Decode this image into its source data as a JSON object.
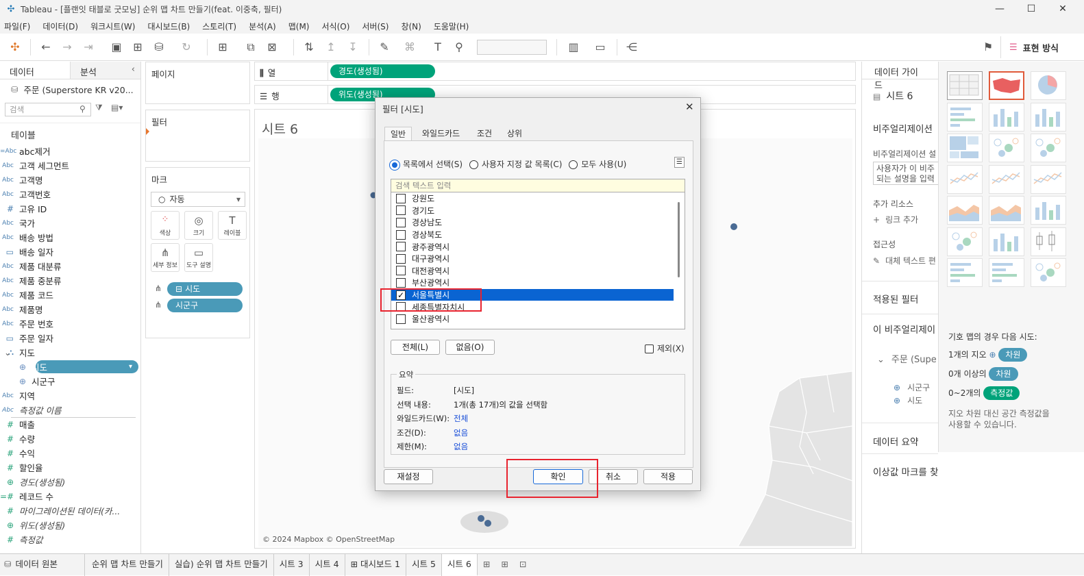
{
  "app": {
    "title": "Tableau - [플랜잇 태블로 굿모닝] 순위 맵 차트 만들기(feat. 이중축, 필터)"
  },
  "menu": [
    "파일(F)",
    "데이터(D)",
    "워크시트(W)",
    "대시보드(B)",
    "스토리(T)",
    "분석(A)",
    "맵(M)",
    "서식(O)",
    "서버(S)",
    "창(N)",
    "도움말(H)"
  ],
  "toolbar": {
    "show_me_label": "표현 방식"
  },
  "data_pane": {
    "tab_data": "데이터",
    "tab_analysis": "분석",
    "datasource": "주문 (Superstore KR v20...",
    "search_placeholder": "검색",
    "tables_header": "테이블",
    "fields": [
      {
        "icon": "=Abc",
        "name": "abc제거",
        "type": "dim"
      },
      {
        "icon": "Abc",
        "name": "고객 세그먼트",
        "type": "dim"
      },
      {
        "icon": "Abc",
        "name": "고객명",
        "type": "dim"
      },
      {
        "icon": "Abc",
        "name": "고객번호",
        "type": "dim"
      },
      {
        "icon": "#",
        "name": "고유 ID",
        "type": "dim"
      },
      {
        "icon": "Abc",
        "name": "국가",
        "type": "dim"
      },
      {
        "icon": "Abc",
        "name": "배송 방법",
        "type": "dim"
      },
      {
        "icon": "▭",
        "name": "배송 일자",
        "type": "dim"
      },
      {
        "icon": "Abc",
        "name": "제품 대분류",
        "type": "dim"
      },
      {
        "icon": "Abc",
        "name": "제품 중분류",
        "type": "dim"
      },
      {
        "icon": "Abc",
        "name": "제품 코드",
        "type": "dim"
      },
      {
        "icon": "Abc",
        "name": "제품명",
        "type": "dim"
      },
      {
        "icon": "Abc",
        "name": "주문 번호",
        "type": "dim"
      },
      {
        "icon": "▭",
        "name": "주문 일자",
        "type": "dim"
      },
      {
        "icon": "⛬",
        "name": "지도",
        "type": "hier"
      },
      {
        "icon": "⊕",
        "name": "시도",
        "type": "geo-selected"
      },
      {
        "icon": "⊕",
        "name": "시군구",
        "type": "geo"
      },
      {
        "icon": "Abc",
        "name": "지역",
        "type": "dim"
      },
      {
        "icon": "Abc",
        "name": "측정값 이름",
        "type": "dim-italic"
      },
      {
        "icon": "#",
        "name": "매출",
        "type": "meas"
      },
      {
        "icon": "#",
        "name": "수량",
        "type": "meas"
      },
      {
        "icon": "#",
        "name": "수익",
        "type": "meas"
      },
      {
        "icon": "#",
        "name": "할인율",
        "type": "meas"
      },
      {
        "icon": "⊕",
        "name": "경도(생성됨)",
        "type": "meas-italic"
      },
      {
        "icon": "=#",
        "name": "레코드 수",
        "type": "meas"
      },
      {
        "icon": "#",
        "name": "마이그레이션된 데이터(카...",
        "type": "meas-italic"
      },
      {
        "icon": "⊕",
        "name": "위도(생성됨)",
        "type": "meas-italic"
      },
      {
        "icon": "#",
        "name": "측정값",
        "type": "meas-italic"
      }
    ]
  },
  "shelves": {
    "pages_label": "페이지",
    "filters_label": "필터",
    "marks_label": "마크",
    "mark_type": "자동",
    "columns_label": "열",
    "rows_label": "행",
    "columns_pill": "경도(생성됨)",
    "rows_pill": "위도(생성됨)",
    "mark_buttons": [
      "색상",
      "크기",
      "레이블",
      "세부 정보",
      "도구 설명"
    ],
    "mark_pills": [
      "시도",
      "시군구"
    ]
  },
  "sheet": {
    "title": "시트 6",
    "attribution": "© 2024 Mapbox © OpenStreetMap"
  },
  "dialog": {
    "title": "필터 [시도]",
    "tabs": [
      "일반",
      "와일드카드",
      "조건",
      "상위"
    ],
    "radio_list": "목록에서 선택(S)",
    "radio_custom": "사용자 지정 값 목록(C)",
    "radio_all": "모두 사용(U)",
    "search_placeholder": "검색 텍스트 입력",
    "items": [
      {
        "label": "강원도",
        "checked": false
      },
      {
        "label": "경기도",
        "checked": false
      },
      {
        "label": "경상남도",
        "checked": false
      },
      {
        "label": "경상북도",
        "checked": false
      },
      {
        "label": "광주광역시",
        "checked": false
      },
      {
        "label": "대구광역시",
        "checked": false
      },
      {
        "label": "대전광역시",
        "checked": false
      },
      {
        "label": "부산광역시",
        "checked": false
      },
      {
        "label": "서울특별시",
        "checked": true
      },
      {
        "label": "세종특별자치시",
        "checked": false
      },
      {
        "label": "울산광역시",
        "checked": false
      }
    ],
    "all_button": "전체(L)",
    "none_button": "없음(O)",
    "exclude_label": "제외(X)",
    "summary_header": "요약",
    "summary": [
      {
        "k": "필드:",
        "v": "[시도]",
        "link": false
      },
      {
        "k": "선택 내용:",
        "v": "1개(총 17개)의 값을 선택함",
        "link": false
      },
      {
        "k": "와일드카드(W):",
        "v": "전체",
        "link": true
      },
      {
        "k": "조건(D):",
        "v": "없음",
        "link": true
      },
      {
        "k": "제한(M):",
        "v": "없음",
        "link": true
      }
    ],
    "reset_button": "재설정",
    "ok_button": "확인",
    "cancel_button": "취소",
    "apply_button": "적용"
  },
  "guide": {
    "header": "데이터 가이드",
    "sheet": "시트 6",
    "viz_header": "비주얼리제이션",
    "viz_desc_label": "비주얼리제이션 설",
    "desc_placeholder": "사용자가 이 비주\n되는 설명을 입력",
    "resources_label": "추가 리소스",
    "add_link": "링크 추가",
    "access_label": "접근성",
    "alt_text": "대체 텍스트 편",
    "applied_filters": "적용된 필터",
    "this_viz": "이 비주얼리제이",
    "datasource": "주문 (Supe",
    "geo1": "시군구",
    "geo2": "시도",
    "data_summary": "데이터 요약",
    "outliers": "이상값 마크를 찾을 수 없음"
  },
  "showme": {
    "hint_title": "기호 맵의 경우 다음 시도:",
    "r1_label": "1개의 지오",
    "r1_chip": "차원",
    "r2_label": "0개 이상의",
    "r2_chip": "차원",
    "r3_label": "0~2개의",
    "r3_chip": "측정값",
    "note": "지오 차원 대신 공간 측정값을\n사용할 수 있습니다.",
    "colors": {
      "dim": "#4a9ab8",
      "meas": "#00a37a"
    }
  },
  "bottom": {
    "datasource_tab": "데이터 원본",
    "sheets": [
      "순위 맵 차트 만들기",
      "실습) 순위 맵 차트 만들기",
      "시트 3",
      "시트 4",
      "대시보드 1",
      "시트 5",
      "시트 6"
    ],
    "active": "시트 6"
  }
}
